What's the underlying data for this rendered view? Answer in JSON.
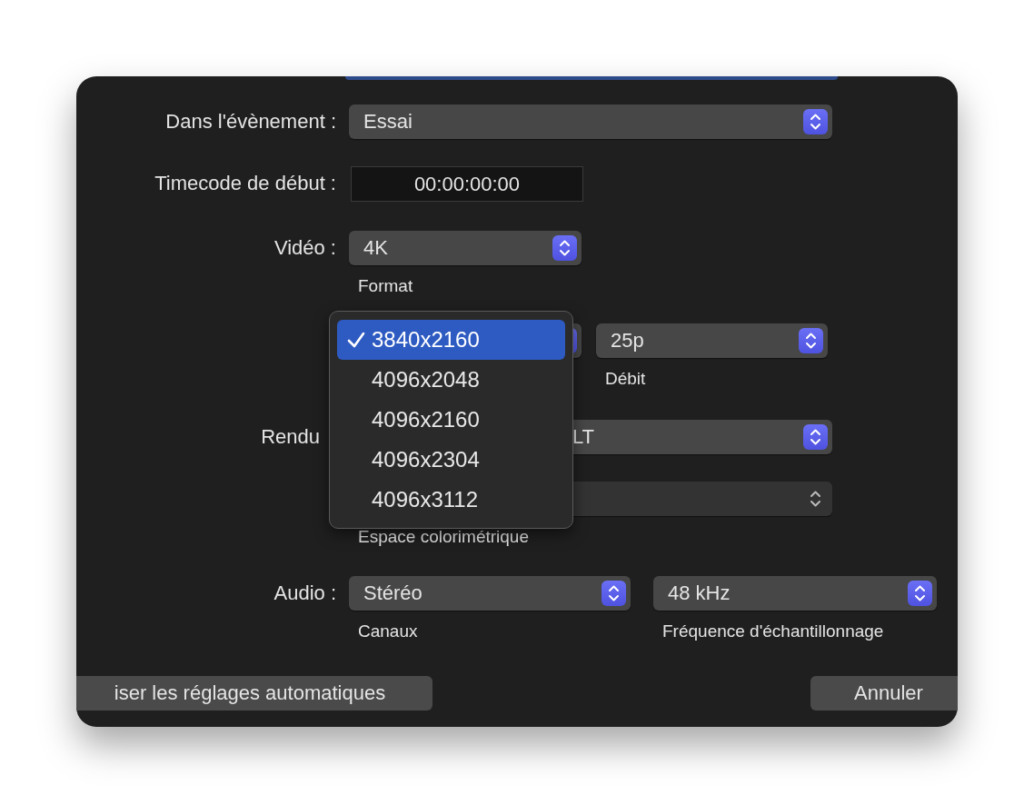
{
  "dialog": {
    "rows": [
      {
        "label": "Dans l'évènement :",
        "controls": [
          {
            "kind": "popup",
            "value": "Essai",
            "disabled": false
          }
        ]
      },
      {
        "label": "Timecode de début :",
        "controls": [
          {
            "kind": "field",
            "value": "00:00:00:00"
          }
        ]
      },
      {
        "label": "Vidéo :",
        "controls": [
          {
            "kind": "popup",
            "value": "4K",
            "caption": "Format",
            "disabled": false
          }
        ]
      },
      {
        "controls": [
          {
            "kind": "popup",
            "disabled": false
          },
          {
            "kind": "popup",
            "value": "25p",
            "caption": "Débit",
            "disabled": false
          }
        ]
      },
      {
        "label": "Rendu",
        "controls": [
          {
            "kind": "popup",
            "value": "LT",
            "disabled": false
          }
        ]
      },
      {
        "controls": [
          {
            "kind": "popup",
            "caption": "Espace colorimétrique",
            "disabled": true
          }
        ]
      },
      {
        "label": "Audio :",
        "controls": [
          {
            "kind": "popup",
            "value": "Stéréo",
            "caption": "Canaux",
            "disabled": false
          },
          {
            "kind": "popup",
            "value": "48 kHz",
            "caption": "Fréquence d'échantillonnage",
            "disabled": false
          }
        ]
      }
    ],
    "buttons": [
      {
        "label": "iser les réglages automatiques"
      },
      {
        "label": "Annuler"
      }
    ],
    "menu": {
      "items": [
        {
          "label": "3840x2160",
          "selected": true
        },
        {
          "label": "4096x2048",
          "selected": false
        },
        {
          "label": "4096x2160",
          "selected": false
        },
        {
          "label": "4096x2304",
          "selected": false
        },
        {
          "label": "4096x3112",
          "selected": false
        }
      ]
    }
  }
}
